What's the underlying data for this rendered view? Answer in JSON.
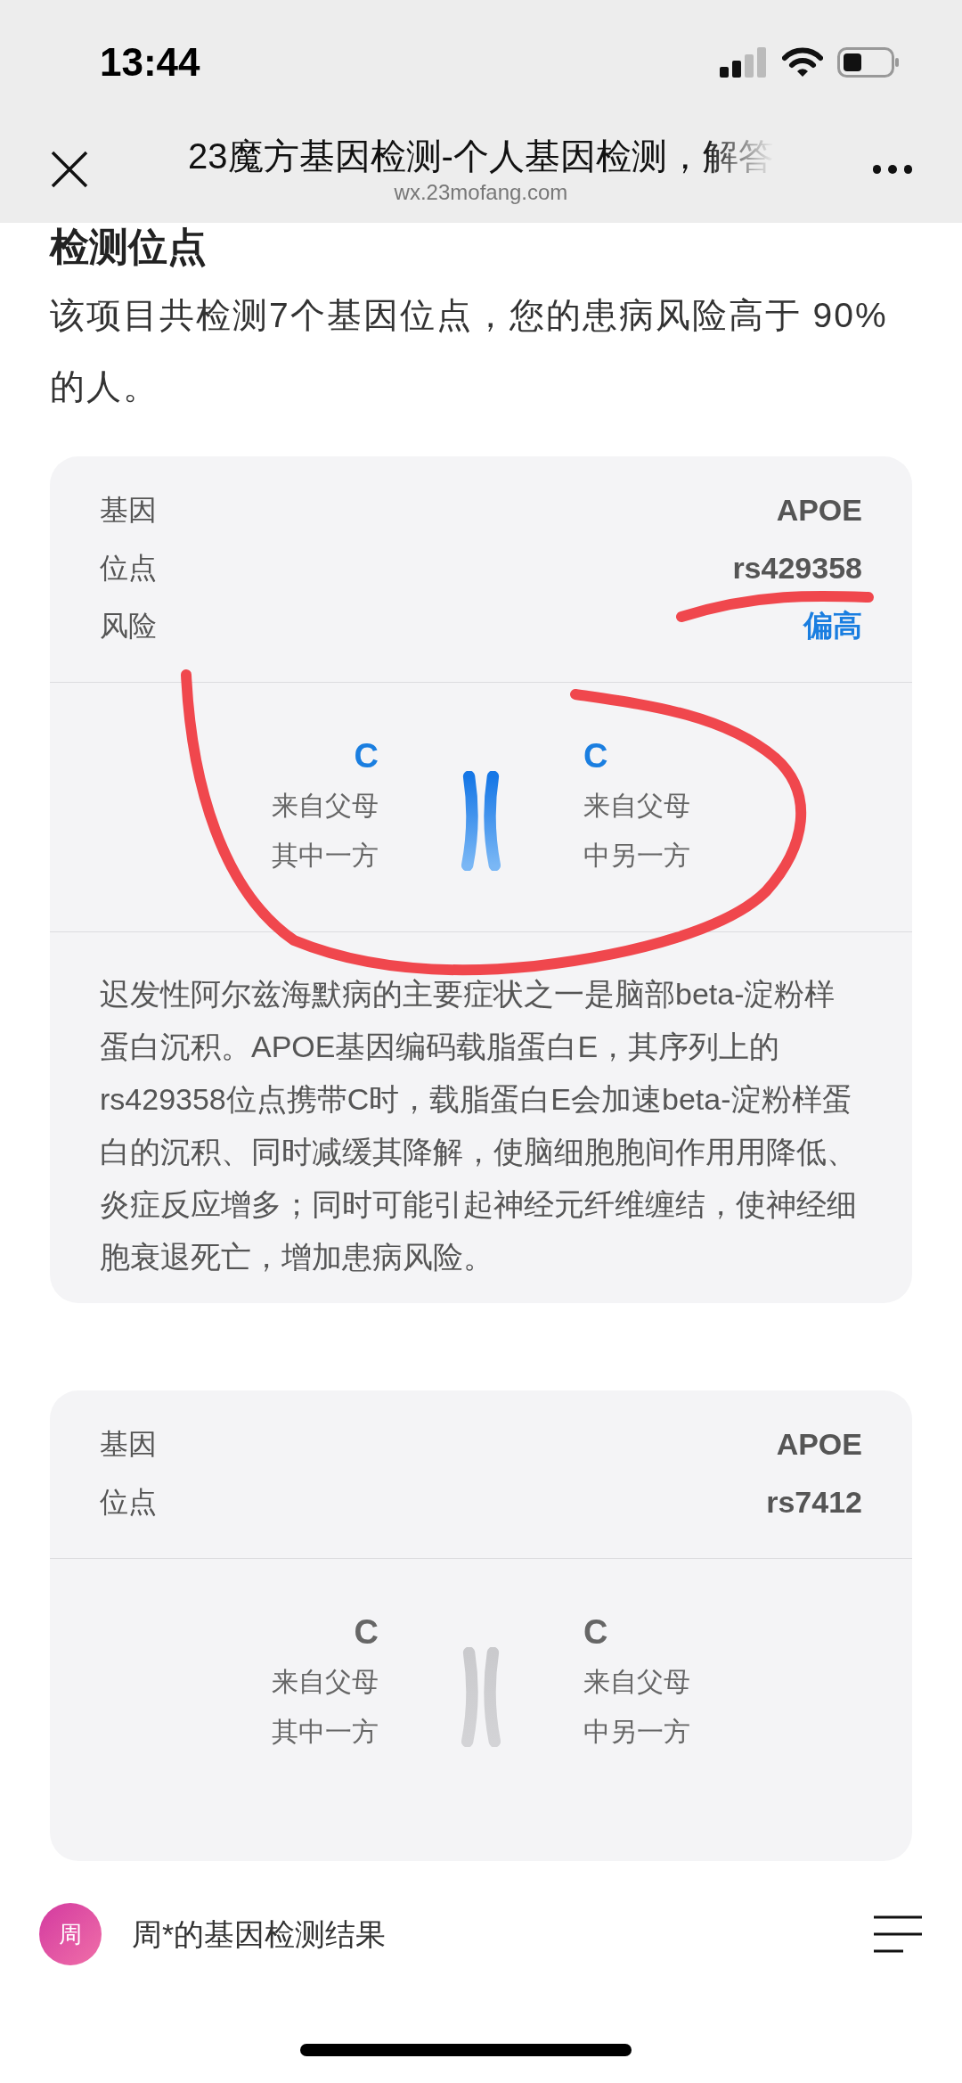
{
  "status_bar": {
    "time": "13:44"
  },
  "header": {
    "title": "23魔方基因检测-个人基因检测，解答",
    "url": "wx.23mofang.com"
  },
  "section": {
    "heading": "检测位点",
    "summary": "该项目共检测7个基因位点，您的患病风险高于 90% 的人。"
  },
  "cards": [
    {
      "highlighted": true,
      "rows": [
        {
          "kind": "plain",
          "label": "基因",
          "value": "APOE"
        },
        {
          "kind": "plain",
          "label": "位点",
          "value": "rs429358"
        },
        {
          "kind": "risk",
          "label": "风险",
          "value": "偏高"
        }
      ],
      "alleles": [
        {
          "base": "C",
          "line1": "来自父母",
          "line2": "其中一方"
        },
        {
          "base": "C",
          "line1": "来自父母",
          "line2": "中另一方"
        }
      ],
      "description": "迟发性阿尔兹海默病的主要症状之一是脑部beta-淀粉样蛋白沉积。APOE基因编码载脂蛋白E，其序列上的rs429358位点携带C时，载脂蛋白E会加速beta-淀粉样蛋白的沉积、同时减缓其降解，使脑细胞胞间作用用降低、炎症反应增多；同时可能引起神经元纤维缠结，使神经细胞衰退死亡，增加患病风险。"
    },
    {
      "highlighted": false,
      "rows": [
        {
          "kind": "plain",
          "label": "基因",
          "value": "APOE"
        },
        {
          "kind": "plain",
          "label": "位点",
          "value": "rs7412"
        }
      ],
      "alleles": [
        {
          "base": "C",
          "line1": "来自父母",
          "line2": "其中一方"
        },
        {
          "base": "C",
          "line1": "来自父母",
          "line2": "中另一方"
        }
      ]
    }
  ],
  "bottom_bar": {
    "avatar": "周",
    "title": "周*的基因检测结果"
  }
}
